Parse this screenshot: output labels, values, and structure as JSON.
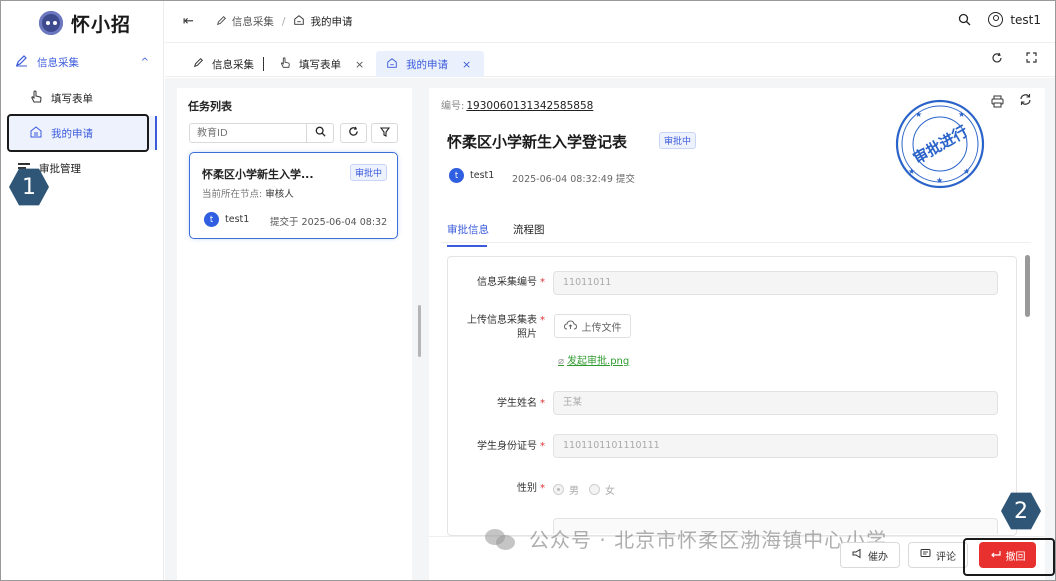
{
  "app": {
    "name": "怀小招"
  },
  "sidebar": {
    "group_label": "信息采集",
    "items": [
      {
        "label": "填写表单"
      },
      {
        "label": "我的申请"
      },
      {
        "label": "审批管理"
      }
    ]
  },
  "header": {
    "breadcrumb": [
      "信息采集",
      "/",
      "我的申请"
    ],
    "user": "test1"
  },
  "tabs": [
    {
      "label": "信息采集"
    },
    {
      "label": "填写表单",
      "close": "×"
    },
    {
      "label": "我的申请",
      "close": "×"
    }
  ],
  "task_list": {
    "title": "任务列表",
    "search_placeholder": "教育ID",
    "card": {
      "title": "怀柔区小学新生入学...",
      "status": "审批中",
      "node_label": "当前所在节点:",
      "node_value": "审核人",
      "user_initial": "t",
      "user": "test1",
      "submitted": "提交于 2025-06-04 08:32"
    }
  },
  "detail": {
    "serial_label": "编号:",
    "serial_number": "1930060131342585858",
    "title": "怀柔区小学新生入学登记表",
    "status": "审批中",
    "submitter_initial": "t",
    "submitter": "test1",
    "submit_time": "2025-06-04 08:32:49 提交",
    "stamp_text": "审批进行",
    "tabs": [
      "审批信息",
      "流程图"
    ],
    "fields": {
      "collect_no_label": "信息采集编号",
      "collect_no_value": "11011011",
      "photo_label_1": "上传信息采集表",
      "photo_label_2": "照片",
      "upload_label": "上传文件",
      "file_name": "发起审批.png",
      "name_label": "学生姓名",
      "name_value": "王某",
      "id_label": "学生身份证号",
      "id_value": "1101101101110111",
      "gender_label": "性别",
      "gender_options": [
        "男",
        "女"
      ],
      "required_mark": "*"
    },
    "actions": {
      "urge": "催办",
      "comment": "评论",
      "withdraw": "撤回"
    }
  },
  "callouts": [
    "1",
    "2"
  ],
  "watermark": "公众号 · 北京市怀柔区渤海镇中心小学",
  "colors": {
    "primary": "#3b5bdb",
    "danger": "#e8312e",
    "callout": "#2f5677",
    "stamp": "#2a63c9",
    "file_link": "#2f9a2f"
  }
}
